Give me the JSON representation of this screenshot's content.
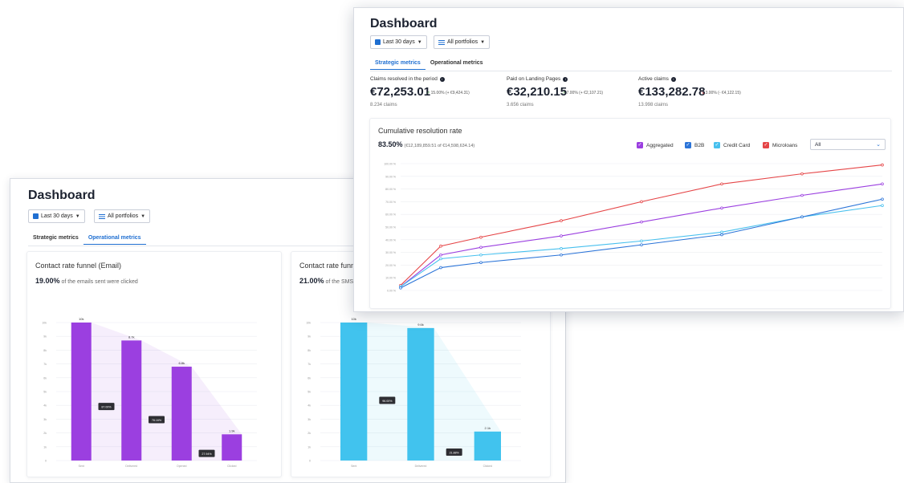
{
  "colors": {
    "accent": "#1f6fd1",
    "purple": "#9b3fe0",
    "cyan": "#41c3ee",
    "red": "#e54547",
    "blue": "#2b74d8",
    "light_blue": "#47c0ee"
  },
  "back": {
    "title": "Dashboard",
    "date_filter": "Last 30 days",
    "portfolio_filter": "All portfolios",
    "tabs": [
      "Strategic metrics",
      "Operational metrics"
    ],
    "active_tab": 1,
    "email_card": {
      "title": "Contact rate funnel (Email)",
      "rate": "19.00%",
      "rate_text": "of the emails sent were clicked"
    },
    "sms_card": {
      "title": "Contact rate funnel (SMS)",
      "rate": "21.00%",
      "rate_text": "of the SMS sent were clicked"
    }
  },
  "front": {
    "title": "Dashboard",
    "date_filter": "Last 30 days",
    "portfolio_filter": "All portfolios",
    "tabs": [
      "Strategic metrics",
      "Operational metrics"
    ],
    "active_tab": 0,
    "metrics": [
      {
        "label": "Claims resolved in the period",
        "value": "€72,253.01",
        "delta": "15.00% (+ €9,424.31)",
        "trend": "up",
        "count": "8.234 claims"
      },
      {
        "label": "Paid on Landing Pages",
        "value": "€32,210.15",
        "delta": "7.00% (+ €2,107.21)",
        "trend": "up",
        "count": "3.656 claims"
      },
      {
        "label": "Active claims",
        "value": "€133,282.78",
        "delta": "3.00% (- €4,122.15)",
        "trend": "down",
        "count": "13.998 claims"
      }
    ],
    "resolution_card": {
      "title": "Cumulative resolution rate",
      "rate": "83.50%",
      "rate_detail": "(€12,189,859.51 of €14,598,634.14)",
      "legend": [
        "Aggregated",
        "B2B",
        "Credit Card",
        "Microloans"
      ],
      "select_value": "All"
    }
  },
  "chart_data": [
    {
      "type": "bar",
      "title": "Contact rate funnel (Email)",
      "categories": [
        "Sent",
        "Delivered",
        "Opened",
        "Clicked"
      ],
      "values": [
        10000,
        8700,
        6800,
        1900
      ],
      "value_labels": [
        "10k",
        "8.7k",
        "6.8k",
        "1.9k"
      ],
      "conversion_labels": [
        "87.00%",
        "78.16%",
        "27.94%"
      ],
      "y_ticks": [
        "0",
        "1k",
        "2k",
        "3k",
        "4k",
        "5k",
        "6k",
        "7k",
        "8k",
        "9k",
        "10k"
      ],
      "ylim": [
        0,
        10000
      ],
      "color": "#9b3fe0",
      "grid": true
    },
    {
      "type": "bar",
      "title": "Contact rate funnel (SMS)",
      "categories": [
        "Sent",
        "Delivered",
        "Clicked"
      ],
      "values": [
        10000,
        9600,
        2100
      ],
      "value_labels": [
        "10k",
        "9.6k",
        "2.1k"
      ],
      "conversion_labels": [
        "96.00%",
        "21.88%"
      ],
      "y_ticks": [
        "0",
        "1k",
        "2k",
        "3k",
        "4k",
        "5k",
        "6k",
        "7k",
        "8k",
        "9k",
        "10k"
      ],
      "ylim": [
        0,
        10000
      ],
      "color": "#41c3ee",
      "grid": true
    },
    {
      "type": "line",
      "title": "Cumulative resolution rate",
      "x": [
        "0",
        "1",
        "2",
        "3",
        "4",
        "5",
        "6",
        "7"
      ],
      "ylim": [
        0,
        100
      ],
      "y_ticks": [
        "0.00 %",
        "10.00 %",
        "20.00 %",
        "30.00 %",
        "40.00 %",
        "50.00 %",
        "60.00 %",
        "70.00 %",
        "80.00 %",
        "90.00 %",
        "100.00 %"
      ],
      "x_positions": [
        0,
        1,
        2,
        4,
        6,
        8,
        10,
        12
      ],
      "series": [
        {
          "name": "Microloans",
          "color": "#e54547",
          "values": [
            4,
            35,
            42,
            55,
            70,
            84,
            92,
            99
          ]
        },
        {
          "name": "Aggregated",
          "color": "#9b3fe0",
          "values": [
            3,
            28,
            34,
            43,
            54,
            65,
            75,
            84
          ]
        },
        {
          "name": "Credit Card",
          "color": "#47c0ee",
          "values": [
            3,
            25,
            28,
            33,
            39,
            46,
            58,
            67
          ]
        },
        {
          "name": "B2B",
          "color": "#2b74d8",
          "values": [
            2,
            18,
            22,
            28,
            36,
            44,
            58,
            72
          ]
        }
      ],
      "legend_position": "top-right",
      "grid": true
    }
  ]
}
